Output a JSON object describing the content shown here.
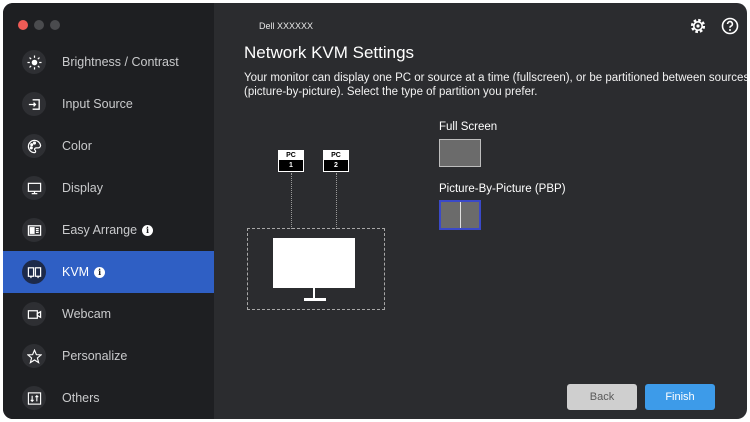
{
  "window": {
    "model": "Dell XXXXXX"
  },
  "sidebar": {
    "items": [
      {
        "label": "Brightness / Contrast",
        "icon": "sun-icon",
        "info": false,
        "active": false
      },
      {
        "label": "Input Source",
        "icon": "input-source-icon",
        "info": false,
        "active": false
      },
      {
        "label": "Color",
        "icon": "palette-icon",
        "info": false,
        "active": false
      },
      {
        "label": "Display",
        "icon": "display-icon",
        "info": false,
        "active": false
      },
      {
        "label": "Easy Arrange",
        "icon": "easy-arrange-icon",
        "info": true,
        "active": false
      },
      {
        "label": "KVM",
        "icon": "kvm-icon",
        "info": true,
        "active": true
      },
      {
        "label": "Webcam",
        "icon": "webcam-icon",
        "info": false,
        "active": false
      },
      {
        "label": "Personalize",
        "icon": "star-icon",
        "info": false,
        "active": false
      },
      {
        "label": "Others",
        "icon": "others-icon",
        "info": false,
        "active": false
      }
    ],
    "info_glyph": "i"
  },
  "main": {
    "title": "Network KVM Settings",
    "description": "Your monitor can display one PC or source at a time (fullscreen), or be partitioned between sources (picture-by-picture). Select the type of partition you prefer.",
    "diagram": {
      "pc1_label": "PC",
      "pc1_number": "1",
      "pc2_label": "PC",
      "pc2_number": "2"
    },
    "options": {
      "full_screen_label": "Full Screen",
      "pbp_label": "Picture-By-Picture (PBP)",
      "selected": "pbp"
    },
    "buttons": {
      "back": "Back",
      "finish": "Finish"
    }
  },
  "colors": {
    "sidebar_bg": "#1e1f22",
    "main_bg": "#2b2c2f",
    "active_item": "#2f5fc4",
    "finish_button": "#3d9be9",
    "selection_border": "#3a49c8"
  }
}
